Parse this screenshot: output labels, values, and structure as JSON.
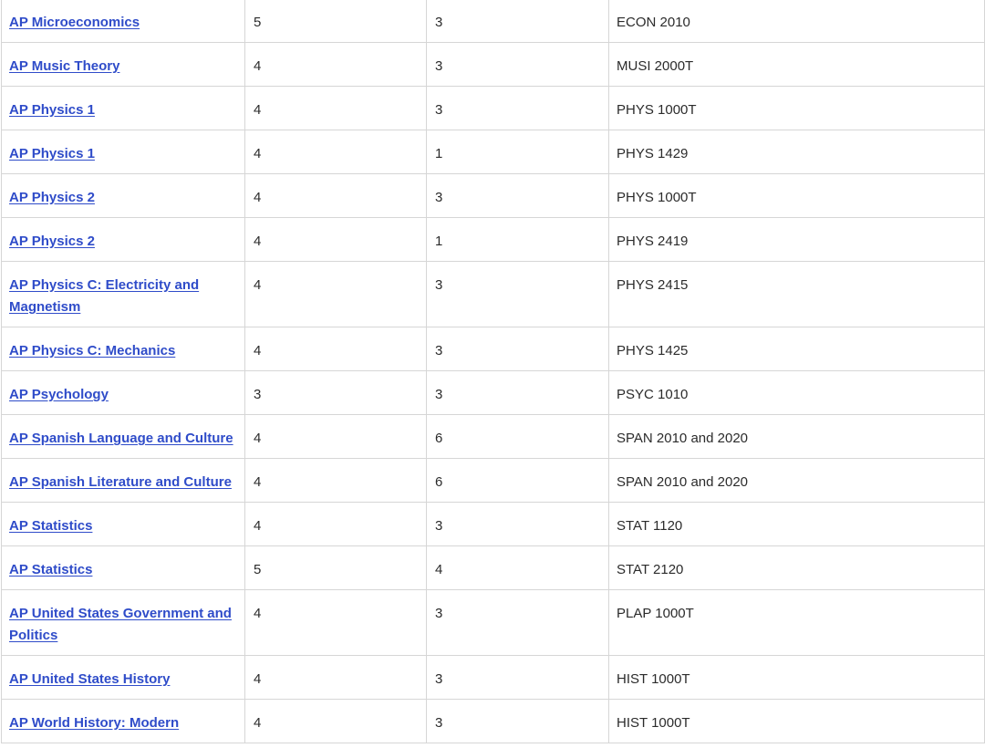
{
  "table": {
    "rows": [
      {
        "exam": "AP Microeconomics",
        "score": "5",
        "credits": "3",
        "course": "ECON 2010"
      },
      {
        "exam": "AP Music Theory",
        "score": "4",
        "credits": "3",
        "course": "MUSI 2000T"
      },
      {
        "exam": "AP Physics 1",
        "score": "4",
        "credits": "3",
        "course": "PHYS 1000T"
      },
      {
        "exam": "AP Physics 1",
        "score": "4",
        "credits": "1",
        "course": "PHYS 1429"
      },
      {
        "exam": "AP Physics 2",
        "score": "4",
        "credits": "3",
        "course": "PHYS 1000T"
      },
      {
        "exam": "AP Physics 2",
        "score": "4",
        "credits": "1",
        "course": "PHYS 2419"
      },
      {
        "exam": "AP Physics C: Electricity and Magnetism",
        "score": "4",
        "credits": "3",
        "course": "PHYS 2415"
      },
      {
        "exam": "AP Physics C: Mechanics",
        "score": "4",
        "credits": "3",
        "course": "PHYS 1425"
      },
      {
        "exam": "AP Psychology",
        "score": "3",
        "credits": "3",
        "course": "PSYC 1010"
      },
      {
        "exam": "AP Spanish Language and Culture",
        "score": "4",
        "credits": "6",
        "course": "SPAN 2010 and 2020"
      },
      {
        "exam": "AP Spanish Literature and Culture",
        "score": "4",
        "credits": "6",
        "course": "SPAN 2010 and 2020"
      },
      {
        "exam": "AP Statistics",
        "score": "4",
        "credits": "3",
        "course": "STAT 1120"
      },
      {
        "exam": "AP Statistics",
        "score": "5",
        "credits": "4",
        "course": "STAT 2120"
      },
      {
        "exam": "AP United States Government and Politics",
        "score": "4",
        "credits": "3",
        "course": "PLAP 1000T"
      },
      {
        "exam": "AP United States History",
        "score": "4",
        "credits": "3",
        "course": "HIST 1000T"
      },
      {
        "exam": "AP World History: Modern",
        "score": "4",
        "credits": "3",
        "course": "HIST 1000T"
      }
    ]
  },
  "colors": {
    "link": "#2f4cc9",
    "text": "#2b2b2b",
    "border": "#d6d6d6"
  }
}
